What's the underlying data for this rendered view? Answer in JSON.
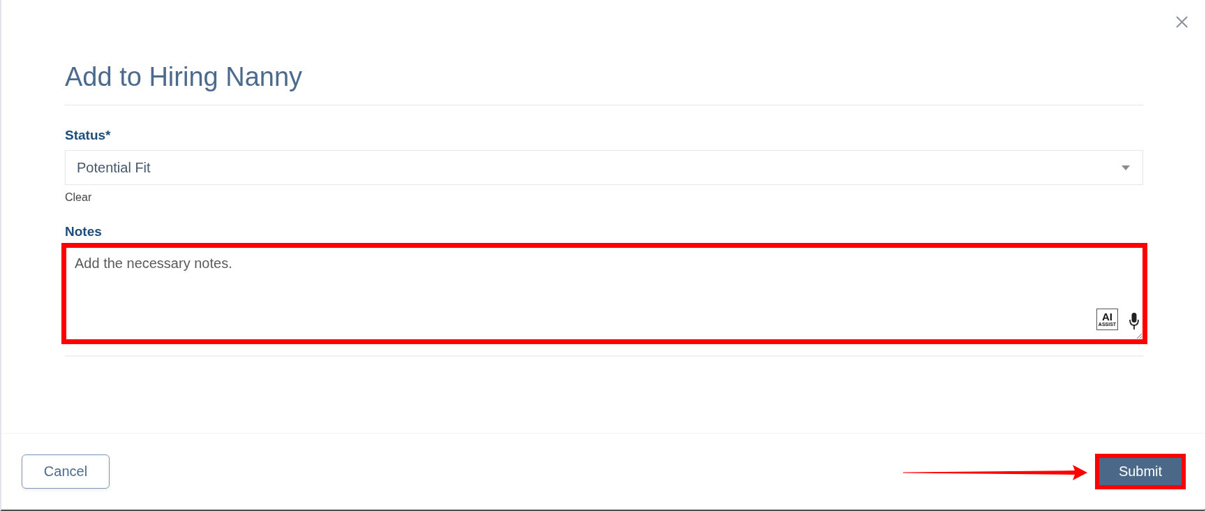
{
  "dialog": {
    "title": "Add to Hiring Nanny"
  },
  "form": {
    "status": {
      "label": "Status*",
      "value": "Potential Fit",
      "clear_label": "Clear"
    },
    "notes": {
      "label": "Notes",
      "placeholder": "Add the necessary notes.",
      "highlighted": true,
      "tools": [
        {
          "kind": "ai-assist",
          "label": "AI",
          "sublabel": "ASSIST"
        },
        {
          "kind": "microphone"
        }
      ]
    }
  },
  "footer": {
    "buttons": [
      {
        "kind": "secondary",
        "label": "Cancel",
        "highlighted": false,
        "annotation_arrow": false
      },
      {
        "kind": "primary",
        "label": "Submit",
        "highlighted": true,
        "annotation_arrow": true
      }
    ]
  }
}
